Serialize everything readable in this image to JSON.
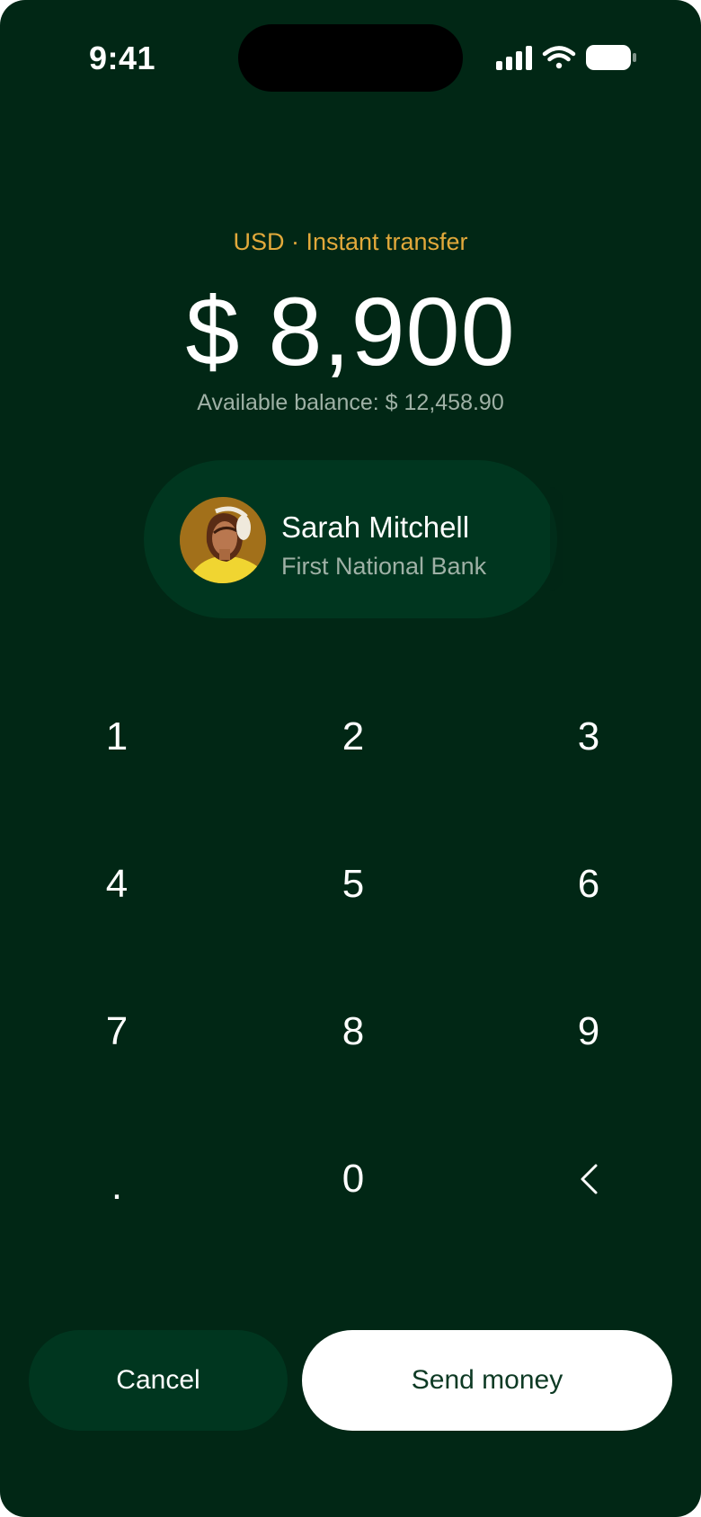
{
  "status_bar": {
    "time": "9:41",
    "icons": [
      "cellular-signal-icon",
      "wifi-icon",
      "battery-icon"
    ]
  },
  "transfer": {
    "meta": "USD · Instant transfer",
    "amount": "$ 8,900",
    "balance": "Available balance: $ 12,458.90"
  },
  "recipient": {
    "name": "Sarah Mitchell",
    "bank": "First National Bank",
    "avatar": "avatar-photo"
  },
  "keypad": {
    "keys": [
      "1",
      "2",
      "3",
      "4",
      "5",
      "6",
      "7",
      "8",
      "9",
      ".",
      "0"
    ],
    "backspace_icon": "chevron-left-icon"
  },
  "actions": {
    "cancel_label": "Cancel",
    "send_label": "Send money"
  },
  "colors": {
    "background": "#012715",
    "surface": "#00361f",
    "accent": "#e2a93b",
    "muted_text": "#9fb1a6",
    "primary_button": "#ffffff",
    "primary_button_text": "#0d3a24"
  }
}
